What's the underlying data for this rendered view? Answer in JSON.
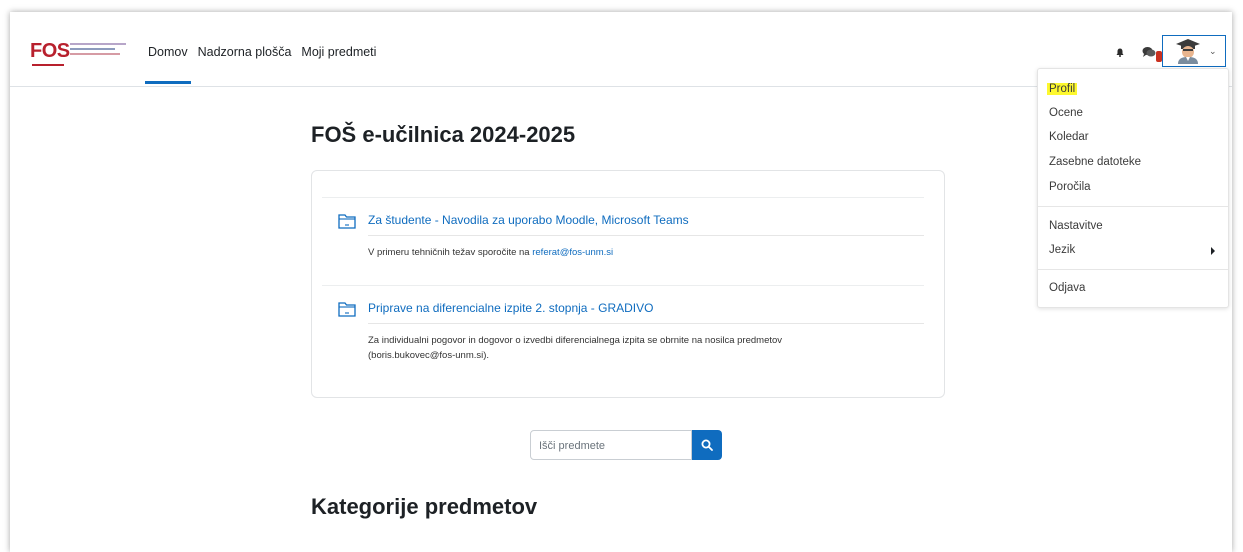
{
  "navbar": {
    "logo_text": "FOS",
    "links": [
      {
        "label": "Domov",
        "active": true
      },
      {
        "label": "Nadzorna plošča",
        "active": false
      },
      {
        "label": "Moji predmeti",
        "active": false
      }
    ],
    "notifications_icon": "bell-icon",
    "messages_icon": "chat-icon",
    "messages_badge_color": "#ca3120",
    "user_avatar_icon": "graduate-avatar-icon"
  },
  "user_menu": {
    "items": [
      {
        "label": "Profil",
        "highlighted": true
      },
      {
        "label": "Ocene"
      },
      {
        "label": "Koledar"
      },
      {
        "label": "Zasebne datoteke"
      },
      {
        "label": "Poročila"
      },
      {
        "label": "Nastavitve"
      },
      {
        "label": "Jezik",
        "has_submenu": true
      },
      {
        "label": "Odjava"
      }
    ]
  },
  "main": {
    "site_title": "FOŠ e-učilnica 2024-2025",
    "courses": [
      {
        "title": "Za študente - Navodila za uporabo Moodle, Microsoft Teams",
        "desc_prefix": "V primeru tehničnih težav sporočite na ",
        "desc_link": "referat@fos-unm.si",
        "desc_suffix": ""
      },
      {
        "title": "Priprave na diferencialne izpite 2. stopnja - GRADIVO",
        "desc_line1": "Za individualni pogovor in dogovor o izvedbi diferencialnega izpita se obrnite na nosilca predmetov",
        "desc_line2": "(boris.bukovec@fos-unm.si)."
      }
    ],
    "search": {
      "placeholder": "Išči predmete",
      "button_icon": "search-icon"
    },
    "categories_title": "Kategorije predmetov"
  },
  "colors": {
    "accent": "#0f6cbf",
    "highlight": "#fdf82e",
    "logo_red": "#b8202d",
    "logo_navy": "#1d2b56"
  }
}
